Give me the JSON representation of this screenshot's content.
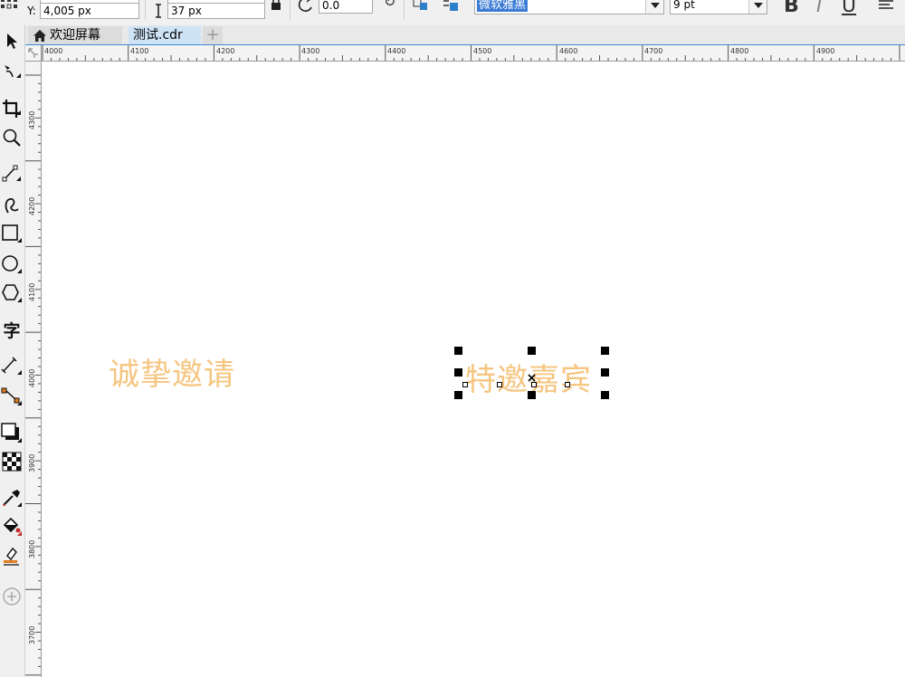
{
  "property_bar": {
    "y_label": "Y:",
    "y_value": "4,005 px",
    "height_value": "37 px",
    "rotation_value": "0.0",
    "font_name": "微软雅黑",
    "font_size": "9 pt",
    "bold_label": "B",
    "italic_label": "I",
    "underline_label": "U"
  },
  "tabs": [
    {
      "label": "欢迎屏幕",
      "active": false
    },
    {
      "label": "测试.cdr",
      "active": true
    }
  ],
  "add_tab_label": "+",
  "ruler": {
    "top_labels": [
      "4000",
      "4100",
      "4200",
      "4300",
      "4400",
      "4500",
      "4600",
      "4700",
      "4800",
      "4900"
    ],
    "left_labels": [
      "4300",
      "4200",
      "4100",
      "4000",
      "3900",
      "3800",
      "3700"
    ],
    "unit": "px"
  },
  "toolbox": {
    "tools": [
      "pick-tool-icon",
      "shape-tool-icon",
      "crop-tool-icon",
      "zoom-tool-icon",
      "freehand-tool-icon",
      "artistic-media-tool-icon",
      "rectangle-tool-icon",
      "ellipse-tool-icon",
      "polygon-tool-icon",
      "text-tool-icon",
      "parallel-dimension-tool-icon",
      "connector-tool-icon",
      "drop-shadow-tool-icon",
      "transparency-tool-icon",
      "eyedropper-tool-icon",
      "interactive-fill-tool-icon",
      "smart-fill-tool-icon",
      "add-tool-icon"
    ],
    "text_tool_glyph": "字"
  },
  "canvas": {
    "text_objects": [
      {
        "text": "诚挚邀请",
        "selected": false
      },
      {
        "text": "特邀嘉宾",
        "selected": true
      }
    ],
    "text_color": "#f6c57f"
  },
  "colors": {
    "selection_highlight": "#3a7bd5",
    "tab_accent": "#3c8ad8"
  }
}
